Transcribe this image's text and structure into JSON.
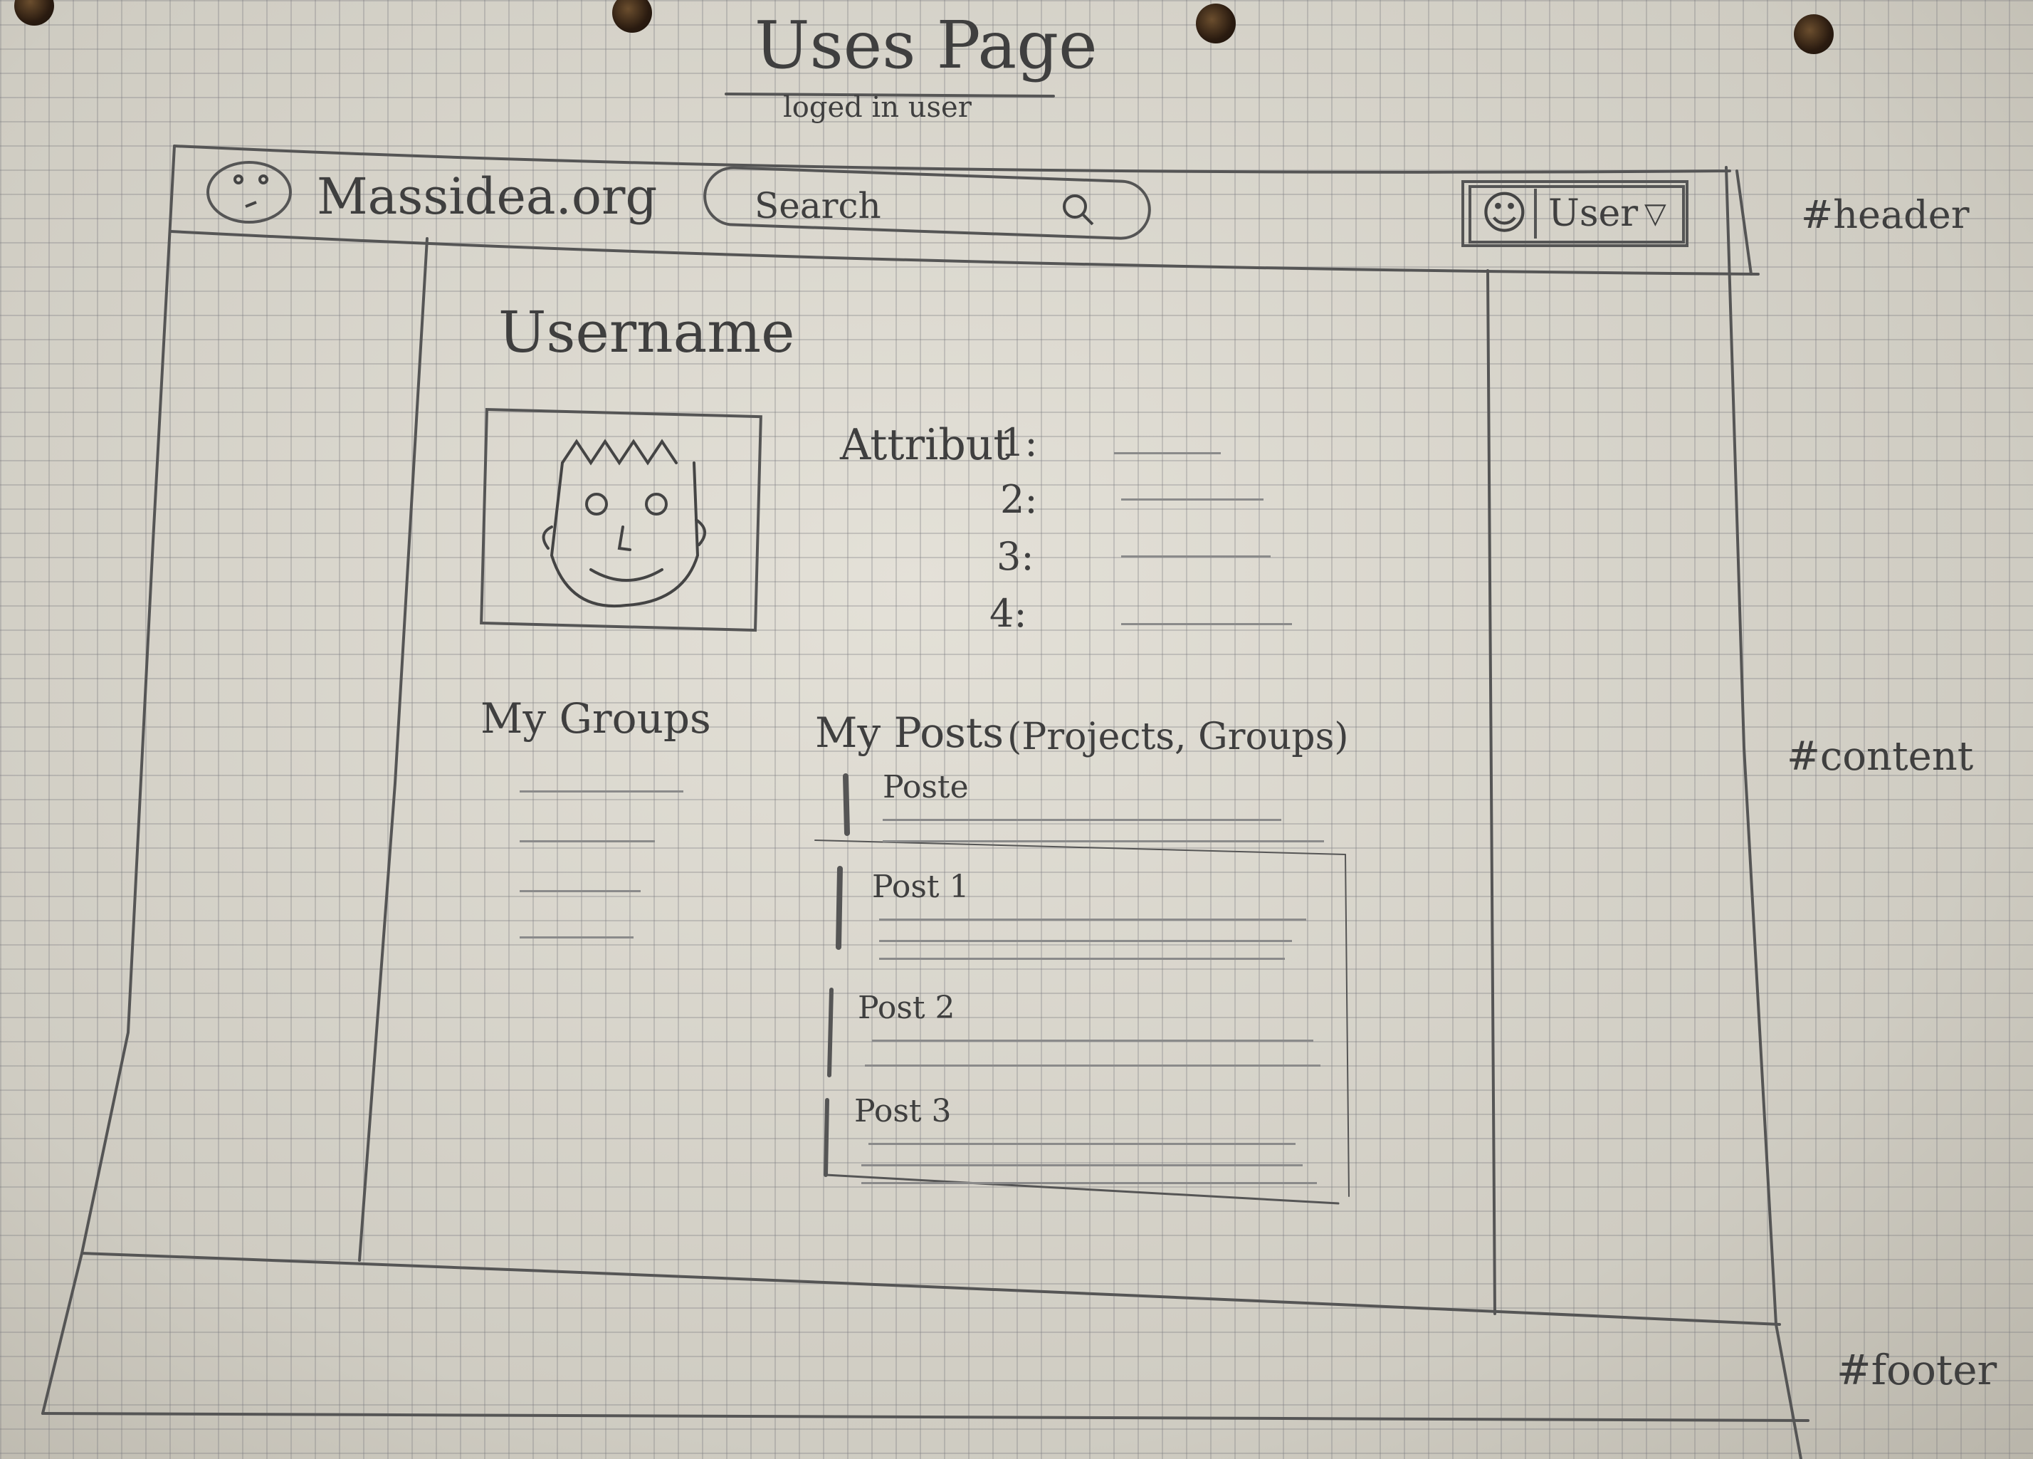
{
  "sheet": {
    "title": "Uses Page",
    "subtitle": "loged in user"
  },
  "header": {
    "logo_icon": "face-icon",
    "site_name": "Massidea.org",
    "search_placeholder": "Search",
    "search_icon": "search-icon",
    "user_menu_icon": "user-icon",
    "user_menu_label": "User",
    "user_menu_caret": "▽",
    "region_label": "#header"
  },
  "content": {
    "username": "Username",
    "attributes_label": "Attribut",
    "attributes": [
      "1:",
      "2:",
      "3:",
      "4:"
    ],
    "my_groups_title": "My Groups",
    "my_posts_title": "My Posts",
    "my_posts_note": "(Projects, Groups)",
    "posts": [
      "Poste",
      "Post 1",
      "Post 2",
      "Post 3"
    ],
    "region_label": "#content"
  },
  "footer": {
    "region_label": "#footer"
  },
  "colors": {
    "paper": "#cfccc2",
    "pencil": "#4a4a4a",
    "grid": "#78787d"
  }
}
